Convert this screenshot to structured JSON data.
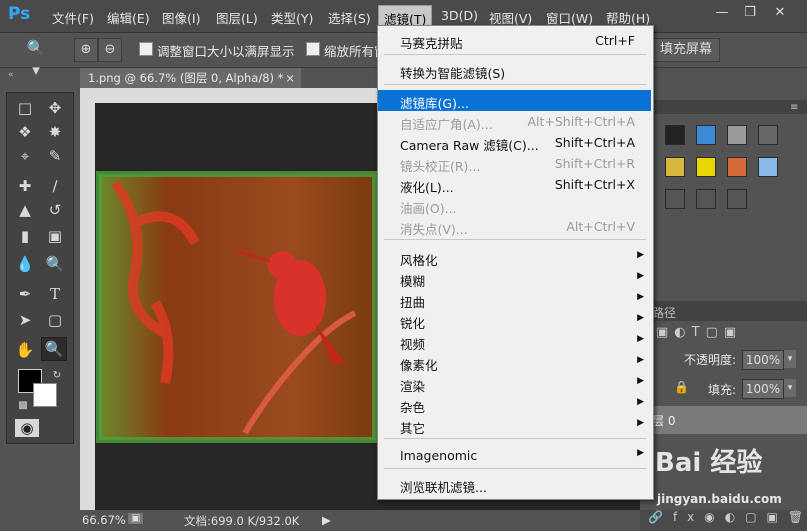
{
  "app": {
    "logo": "Ps"
  },
  "menubar": {
    "items": [
      "文件(F)",
      "编辑(E)",
      "图像(I)",
      "图层(L)",
      "类型(Y)",
      "选择(S)",
      "滤镜(T)",
      "3D(D)",
      "视图(V)",
      "窗口(W)",
      "帮助(H)"
    ],
    "active": "滤镜(T)"
  },
  "options": {
    "resize_label": "调整窗口大小以满屏显示",
    "zoom_all_label": "缩放所有窗",
    "fill_screen_label": "填充屏幕"
  },
  "document": {
    "tab_title": "1.png @ 66.7% (图层 0, Alpha/8) *",
    "zoom": "66.67%",
    "doc_info": "文档:699.0 K/932.0K"
  },
  "layers_panel": {
    "path_tab": "路径",
    "opacity_label": "不透明度:",
    "opacity_value": "100%",
    "fill_label": "填充:",
    "fill_value": "100%",
    "layer_name": "层 0"
  },
  "filter_menu": {
    "items": [
      {
        "label": "马赛克拼贴",
        "shortcut": "Ctrl+F",
        "state": "normal"
      },
      {
        "label": "转换为智能滤镜(S)",
        "shortcut": "",
        "state": "normal"
      },
      {
        "label": "滤镜库(G)...",
        "shortcut": "",
        "state": "highlighted"
      },
      {
        "label": "自适应广角(A)...",
        "shortcut": "Alt+Shift+Ctrl+A",
        "state": "disabled"
      },
      {
        "label": "Camera Raw 滤镜(C)...",
        "shortcut": "Shift+Ctrl+A",
        "state": "normal"
      },
      {
        "label": "镜头校正(R)...",
        "shortcut": "Shift+Ctrl+R",
        "state": "disabled"
      },
      {
        "label": "液化(L)...",
        "shortcut": "Shift+Ctrl+X",
        "state": "normal"
      },
      {
        "label": "油画(O)...",
        "shortcut": "",
        "state": "disabled"
      },
      {
        "label": "消失点(V)...",
        "shortcut": "Alt+Ctrl+V",
        "state": "disabled"
      },
      {
        "label": "风格化",
        "shortcut": "",
        "state": "submenu"
      },
      {
        "label": "模糊",
        "shortcut": "",
        "state": "submenu"
      },
      {
        "label": "扭曲",
        "shortcut": "",
        "state": "submenu"
      },
      {
        "label": "锐化",
        "shortcut": "",
        "state": "submenu"
      },
      {
        "label": "视频",
        "shortcut": "",
        "state": "submenu"
      },
      {
        "label": "像素化",
        "shortcut": "",
        "state": "submenu"
      },
      {
        "label": "渲染",
        "shortcut": "",
        "state": "submenu"
      },
      {
        "label": "杂色",
        "shortcut": "",
        "state": "submenu"
      },
      {
        "label": "其它",
        "shortcut": "",
        "state": "submenu"
      },
      {
        "label": "Imagenomic",
        "shortcut": "",
        "state": "submenu"
      },
      {
        "label": "浏览联机滤镜...",
        "shortcut": "",
        "state": "normal"
      }
    ]
  },
  "watermark": {
    "brand": "Bai 经验",
    "url": "jingyan.baidu.com"
  },
  "colors": {
    "highlight": "#0a72d4",
    "menu_bg": "#f0f0f0",
    "ps_blue": "#31a8ff"
  }
}
